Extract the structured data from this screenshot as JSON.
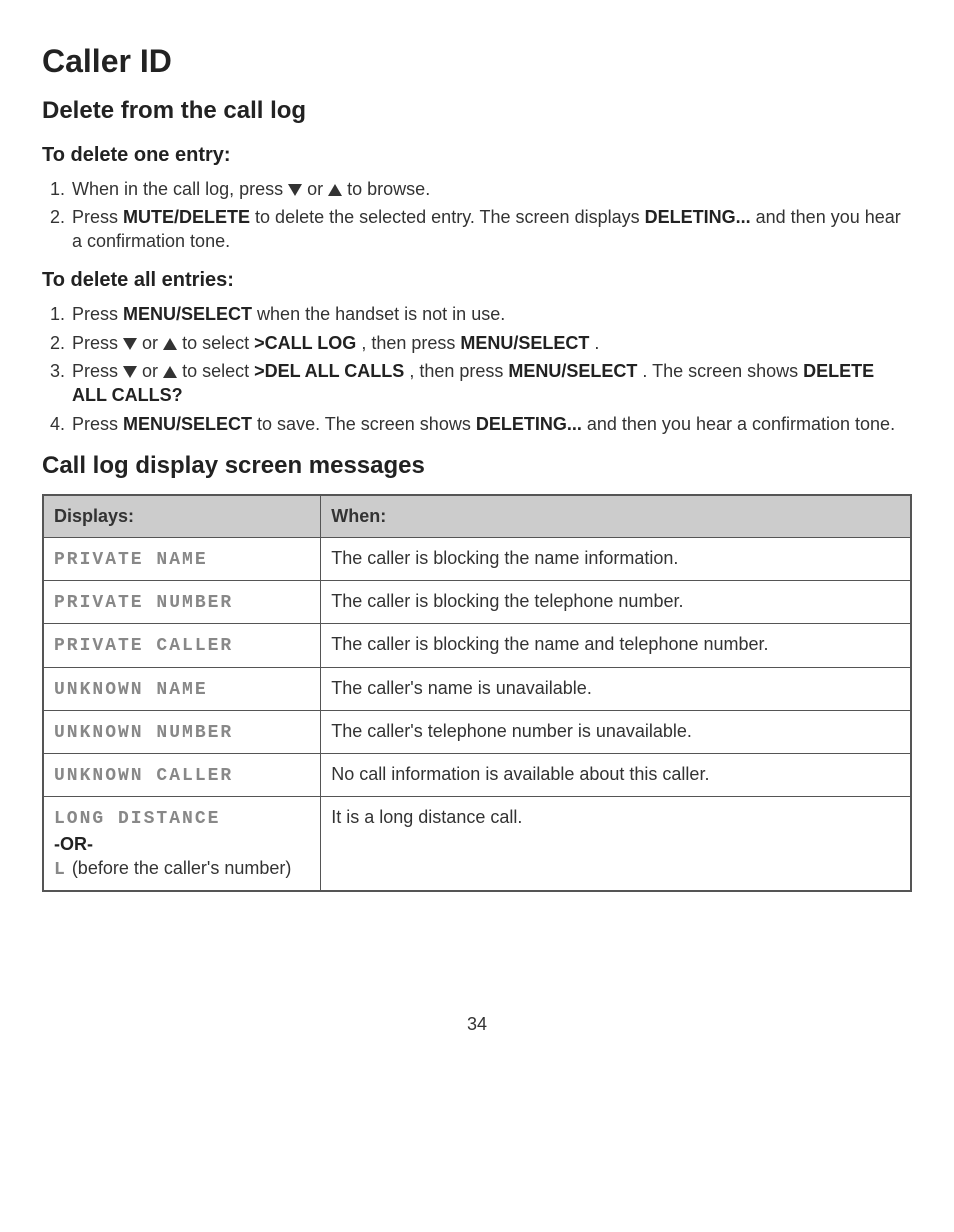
{
  "title": "Caller ID",
  "section1": "Delete from the call log",
  "sub1a": "To delete one entry:",
  "list1a": {
    "i1_pre": "When in the call log, press ",
    "i1_mid": " or ",
    "i1_post": " to browse.",
    "i2_a": "Press ",
    "i2_cmd": "MUTE/DELETE",
    "i2_b": " to delete the selected entry. The screen displays ",
    "i2_c": "DELETING...",
    "i2_d": " and then you hear a confirmation tone."
  },
  "sub1b": "To delete all entries:",
  "list1b": {
    "i1_a": "Press ",
    "i1_cmd": "MENU/SELECT",
    "i1_b": " when the handset is not in use.",
    "i2_a": "Press ",
    "i2_mid": " or ",
    "i2_b": " to select ",
    "i2_opt": ">CALL LOG",
    "i2_c": ", then press ",
    "i2_cmd": "MENU/SELECT",
    "i2_d": ".",
    "i3_a": "Press ",
    "i3_mid": " or ",
    "i3_b": " to select ",
    "i3_opt": ">DEL ALL CALLS",
    "i3_c": ", then press ",
    "i3_cmd": "MENU/SELECT",
    "i3_d": ". The screen shows ",
    "i3_scr": "DELETE ALL CALLS?",
    "i4_a": "Press ",
    "i4_cmd": "MENU/SELECT",
    "i4_b": " to save. The screen shows ",
    "i4_scr": "DELETING...",
    "i4_c": " and then you hear a confirmation tone."
  },
  "section2": "Call log display screen messages",
  "table": {
    "headers": {
      "displays": "Displays:",
      "when": "When:"
    },
    "rows": [
      {
        "display": "PRIVATE NAME",
        "when": "The caller is blocking the name information."
      },
      {
        "display": "PRIVATE NUMBER",
        "when": "The caller is blocking the telephone number."
      },
      {
        "display": "PRIVATE CALLER",
        "when": "The caller is blocking the name and telephone number."
      },
      {
        "display": "UNKNOWN NAME",
        "when": "The caller's name is unavailable."
      },
      {
        "display": "UNKNOWN NUMBER",
        "when": "The caller's telephone number is unavailable."
      },
      {
        "display": "UNKNOWN CALLER",
        "when": "No call information is available about this caller."
      }
    ],
    "last": {
      "display": "LONG DISTANCE",
      "or": "-OR-",
      "prefix": "L",
      "tail": " (before the caller's number)",
      "when": "It is a long distance call."
    }
  },
  "page": "34"
}
